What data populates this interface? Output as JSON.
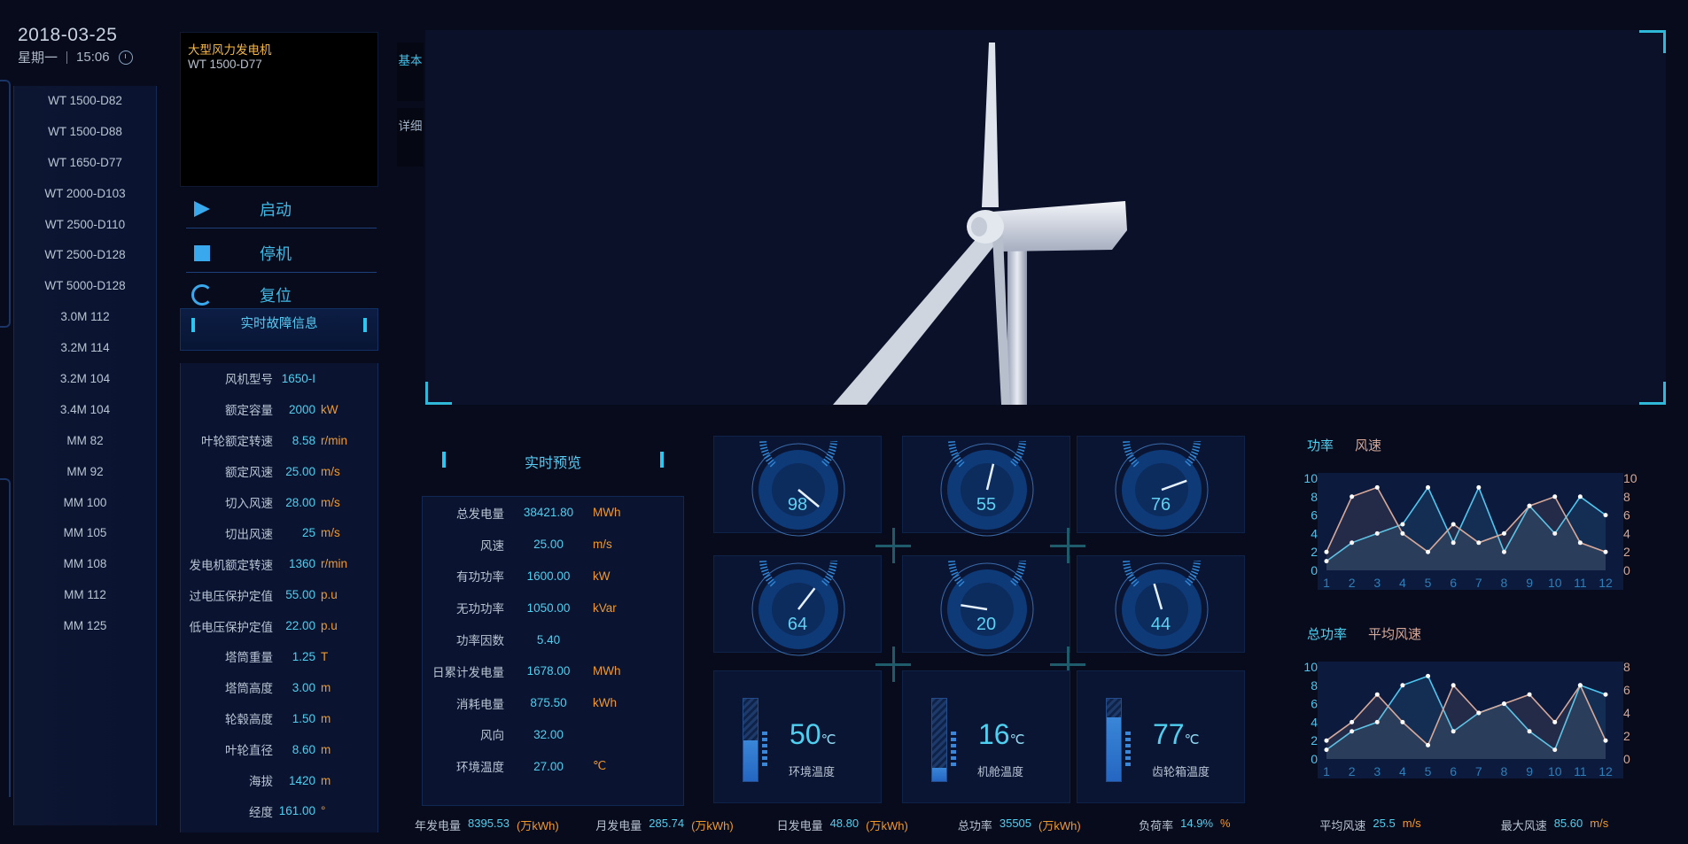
{
  "datetime": {
    "date": "2018-03-25",
    "weekday": "星期一",
    "time": "15:06"
  },
  "turbine_list": [
    "WT 1500-D82",
    "WT 1500-D88",
    "WT 1650-D77",
    "WT 2000-D103",
    "WT 2500-D110",
    "WT 2500-D128",
    "WT 5000-D128",
    "3.0M 112",
    "3.2M 114",
    "3.2M 104",
    "3.4M 104",
    "MM 82",
    "MM 92",
    "MM 100",
    "MM 105",
    "MM 108",
    "MM 112",
    "MM 125"
  ],
  "info": {
    "title": "大型风力发电机",
    "model": "WT 1500-D77"
  },
  "controls": {
    "start": "启动",
    "stop": "停机",
    "reset": "复位"
  },
  "fault_header": "实时故障信息",
  "params": [
    {
      "label": "风机型号",
      "value": "1650-I",
      "unit": ""
    },
    {
      "label": "额定容量",
      "value": "2000",
      "unit": "kW"
    },
    {
      "label": "叶轮额定转速",
      "value": "8.58",
      "unit": "r/min"
    },
    {
      "label": "额定风速",
      "value": "25.00",
      "unit": "m/s"
    },
    {
      "label": "切入风速",
      "value": "28.00",
      "unit": "m/s"
    },
    {
      "label": "切出风速",
      "value": "25",
      "unit": "m/s"
    },
    {
      "label": "发电机额定转速",
      "value": "1360",
      "unit": "r/min"
    },
    {
      "label": "过电压保护定值",
      "value": "55.00",
      "unit": "p.u"
    },
    {
      "label": "低电压保护定值",
      "value": "22.00",
      "unit": "p.u"
    },
    {
      "label": "塔筒重量",
      "value": "1.25",
      "unit": "T"
    },
    {
      "label": "塔筒高度",
      "value": "3.00",
      "unit": "m"
    },
    {
      "label": "轮毂高度",
      "value": "1.50",
      "unit": "m"
    },
    {
      "label": "叶轮直径",
      "value": "8.60",
      "unit": "m"
    },
    {
      "label": "海拔",
      "value": "1420",
      "unit": "m"
    },
    {
      "label": "经度",
      "value": "161.00",
      "unit": "°"
    }
  ],
  "side_tabs": [
    "基本",
    "详细"
  ],
  "preview_header": "实时预览",
  "preview": [
    {
      "label": "总发电量",
      "value": "38421.80",
      "unit": "MWh"
    },
    {
      "label": "风速",
      "value": "25.00",
      "unit": "m/s"
    },
    {
      "label": "有功功率",
      "value": "1600.00",
      "unit": "kW"
    },
    {
      "label": "无功功率",
      "value": "1050.00",
      "unit": "kVar"
    },
    {
      "label": "功率因数",
      "value": "5.40",
      "unit": ""
    },
    {
      "label": "日累计发电量",
      "value": "1678.00",
      "unit": "MWh"
    },
    {
      "label": "消耗电量",
      "value": "875.50",
      "unit": "kWh"
    },
    {
      "label": "风向",
      "value": "32.00",
      "unit": ""
    },
    {
      "label": "环境温度",
      "value": "27.00",
      "unit": "℃"
    }
  ],
  "gauges": [
    98,
    55,
    76,
    64,
    20,
    44
  ],
  "temps": [
    {
      "value": "50",
      "unit": "℃",
      "label": "环境温度",
      "level": 0.5
    },
    {
      "value": "16",
      "unit": "℃",
      "label": "机舱温度",
      "level": 0.16
    },
    {
      "value": "77",
      "unit": "℃",
      "label": "齿轮箱温度",
      "level": 0.77
    }
  ],
  "colors": {
    "accent": "#4fd0f0",
    "orange": "#f09a2c",
    "series_a": "#4fc6f0",
    "series_b": "#d7a99a"
  },
  "chart_data": [
    {
      "type": "line",
      "x": [
        1,
        2,
        3,
        4,
        5,
        6,
        7,
        8,
        9,
        10,
        11,
        12
      ],
      "series": [
        {
          "name": "功率",
          "values": [
            1,
            3,
            4,
            5,
            9,
            3,
            9,
            2,
            7,
            4,
            8,
            6
          ]
        },
        {
          "name": "风速",
          "values": [
            2,
            8,
            9,
            4,
            2,
            5,
            3,
            4,
            7,
            8,
            3,
            2
          ]
        }
      ],
      "ylim_left": [
        0,
        10
      ],
      "ylim_right": [
        0,
        10
      ],
      "left_ticks": [
        "0",
        "2",
        "4",
        "6",
        "8",
        "10"
      ],
      "right_ticks": [
        "0",
        "2",
        "4",
        "6",
        "8",
        "10"
      ]
    },
    {
      "type": "line",
      "x": [
        1,
        2,
        3,
        4,
        5,
        6,
        7,
        8,
        9,
        10,
        11,
        12
      ],
      "series": [
        {
          "name": "总功率",
          "values": [
            1,
            3,
            4,
            8,
            9,
            3,
            5,
            6,
            3,
            1,
            8,
            7
          ]
        },
        {
          "name": "平均风速",
          "values": [
            1.6,
            3.2,
            5.6,
            3.2,
            1.2,
            6.4,
            4,
            4.8,
            5.6,
            3.2,
            6.4,
            1.6
          ]
        }
      ],
      "ylim_left": [
        0,
        10
      ],
      "ylim_right": [
        0,
        8
      ],
      "left_ticks": [
        "0",
        "2",
        "4",
        "6",
        "8",
        "10"
      ],
      "right_ticks": [
        "0",
        "2",
        "4",
        "6",
        "8"
      ]
    }
  ],
  "stats": [
    {
      "label": "年发电量",
      "value": "8395.53",
      "unit": "(万kWh)"
    },
    {
      "label": "月发电量",
      "value": "285.74",
      "unit": "(万kWh)"
    },
    {
      "label": "日发电量",
      "value": "48.80",
      "unit": "(万kWh)"
    },
    {
      "label": "总功率",
      "value": "35505",
      "unit": "(万kWh)"
    },
    {
      "label": "负荷率",
      "value": "14.9%",
      "unit": "%"
    },
    {
      "label": "平均风速",
      "value": "25.5",
      "unit": "m/s"
    },
    {
      "label": "最大风速",
      "value": "85.60",
      "unit": "m/s"
    }
  ]
}
